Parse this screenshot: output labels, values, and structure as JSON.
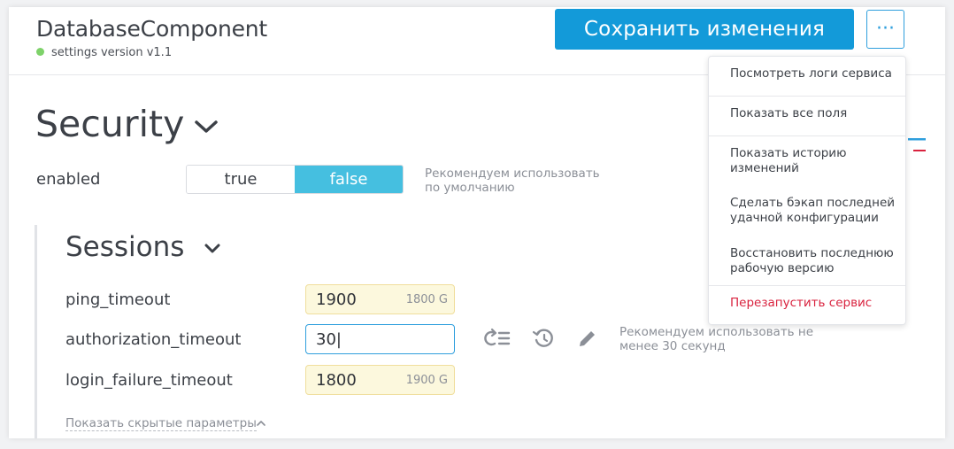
{
  "header": {
    "title": "DatabaseComponent",
    "version": "settings version v1.1",
    "status_color": "#7ed26a",
    "save_label": "Сохранить изменения",
    "more_label": "···"
  },
  "security": {
    "title": "Security",
    "enabled": {
      "label": "enabled",
      "options": [
        "true",
        "false"
      ],
      "selected": "false",
      "hint": "Рекомендуем использовать по умолчанию"
    }
  },
  "sessions": {
    "title": "Sessions",
    "fields": [
      {
        "label": "ping_timeout",
        "value": "1900",
        "default": "1800 G"
      },
      {
        "label": "authorization_timeout",
        "value": "30|",
        "default": ""
      },
      {
        "label": "login_failure_timeout",
        "value": "1800",
        "default": "1900 G"
      }
    ],
    "authorization_hint": "Рекомендуем использовать не менее 30 секунд",
    "show_hidden": "Показать скрытые параметры"
  },
  "menu": {
    "items": [
      {
        "label": "Посмотреть логи сервиса"
      },
      {
        "label": "Показать все поля"
      },
      {
        "label": "Показать историю изменений"
      },
      {
        "label": "Сделать бэкап последней удачной конфигурации"
      },
      {
        "label": "Восстановить последнюю рабочую версию"
      },
      {
        "label": "Перезапустить сервис"
      }
    ]
  },
  "colors": {
    "accent": "#139ad9",
    "toggle_active": "#45bfe0",
    "modified_field_bg": "#fcf8dd",
    "danger": "#d9223e"
  }
}
